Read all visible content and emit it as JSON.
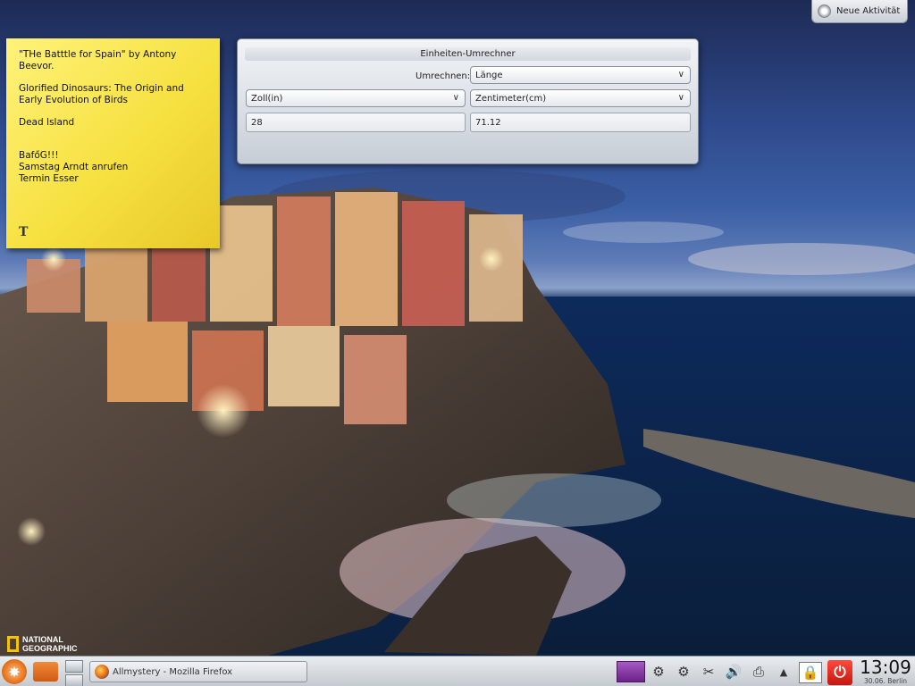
{
  "desktop": {
    "activity_button": {
      "label": "Neue Aktivität"
    },
    "watermark": {
      "line1": "NATIONAL",
      "line2": "GEOGRAPHIC"
    }
  },
  "sticky_note": {
    "lines": [
      "\"THe Batttle for Spain\" by Antony Beevor.",
      "Glorified Dinosaurs: The Origin and Early Evolution of Birds",
      "Dead Island",
      "BafőG!!!\nSamstag Arndt anrufen\nTermin Esser"
    ],
    "tool_icon": "text-format-icon",
    "tool_glyph": "T"
  },
  "converter": {
    "title": "Einheiten-Umrechner",
    "umrechnen_label": "Umrechnen:",
    "category_value": "Länge",
    "from_unit": "Zoll(in)",
    "to_unit": "Zentimeter(cm)",
    "from_value": "28",
    "to_value": "71.12"
  },
  "taskbar": {
    "window_title": "Allmystery - Mozilla Firefox",
    "clock": {
      "time": "13:09",
      "date": "30.06. Berlin"
    },
    "icons": [
      "application-launcher-icon",
      "folder-icon",
      "pager-icon",
      "firefox-icon",
      "media-icon",
      "gear-icon",
      "gear-icon",
      "scissors-icon",
      "volume-icon",
      "printer-icon",
      "up-arrow-icon",
      "lock-icon",
      "power-icon"
    ]
  }
}
